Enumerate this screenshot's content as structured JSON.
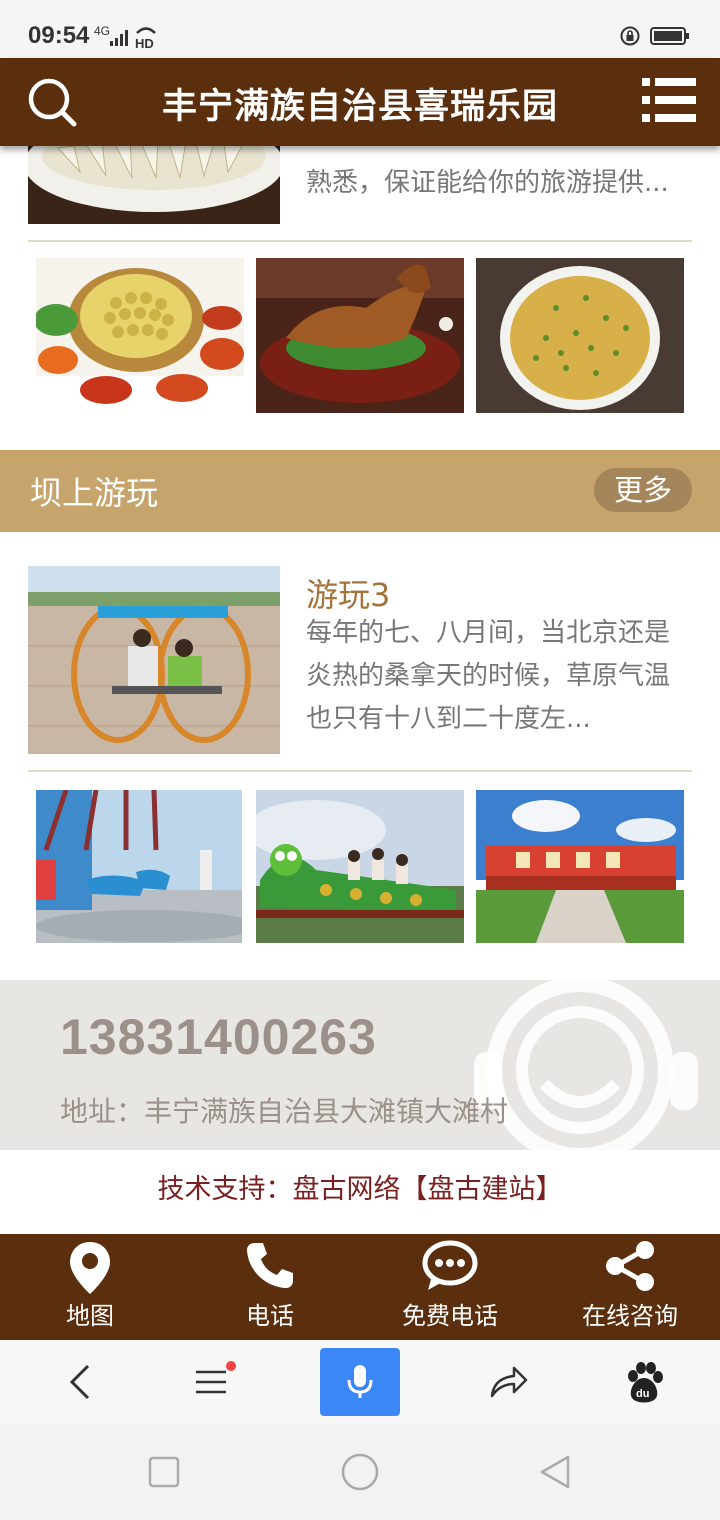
{
  "status_bar": {
    "time": "09:54",
    "signal": "4G",
    "hd": "HD"
  },
  "header": {
    "title": "丰宁满族自治县喜瑞乐园"
  },
  "food_section": {
    "feature_desc": "熟悉，保证能给你的旅游提供..."
  },
  "play_section": {
    "title": "坝上游玩",
    "more": "更多",
    "feature": {
      "title": "游玩3",
      "desc": "每年的七、八月间，当北京还是炎热的桑拿天的时候，草原气温也只有十八到二十度左..."
    }
  },
  "contact": {
    "phone": "13831400263",
    "address": "地址：丰宁满族自治县大滩镇大滩村"
  },
  "footer": {
    "tech_support": "技术支持：盘古网络【盘古建站】"
  },
  "bottom_nav": {
    "items": [
      {
        "label": "地图",
        "icon": "map-pin-icon"
      },
      {
        "label": "电话",
        "icon": "phone-icon"
      },
      {
        "label": "免费电话",
        "icon": "chat-bubble-icon"
      },
      {
        "label": "在线咨询",
        "icon": "share-icon"
      }
    ]
  },
  "colors": {
    "header": "#5b2f0d",
    "section_bar": "#c6a46c",
    "more_button": "#a4865a",
    "feature_title": "#a3733c",
    "contact_bg": "#e8e6e2",
    "tech_support_text": "#7a2020",
    "mic_button": "#3a87f5"
  }
}
